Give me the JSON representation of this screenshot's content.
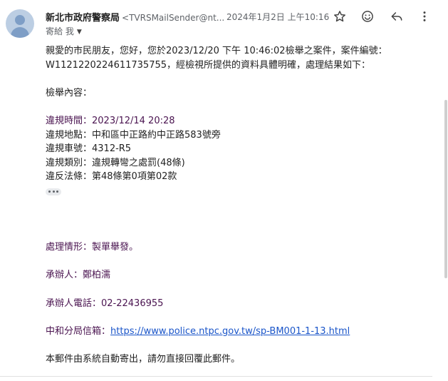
{
  "header": {
    "sender_name": "新北市政府警察局",
    "sender_email": "<TVRSMailSender@nt...",
    "date": "2024年1月2日 上午10:16",
    "recipient_label": "寄給 我",
    "icons": [
      "star-icon",
      "emoji-icon",
      "reply-icon",
      "more-vert-icon"
    ]
  },
  "body": {
    "greeting1": "親愛的市民朋友，您好，您於2023/12/20 下午 10:46:02檢舉之案件，案件編號：",
    "greeting2": "W1121220224611735755，經檢視所提供的資料具體明確，處理結果如下：",
    "report_title": "檢舉內容：",
    "violation_time": "違規時間：2023/12/14 20:28",
    "violation_place": "違規地點：中和區中正路約中正路583號旁",
    "plate": "違規車號：4312-R5",
    "category": "違規類別：違規轉彎之處罰(48條)",
    "law": "違反法條：第48條第0項第02款",
    "handling": "處理情形：製單舉發。",
    "handler": "承辦人：鄭柏濡",
    "phone": "承辦人電話：02-22436955",
    "mailbox_label": "中和分局信箱：",
    "mailbox_url": "https://www.police.ntpc.gov.tw/sp-BM001-1-13.html",
    "footer": "本郵件由系統自動寄出，請勿直接回覆此郵件。"
  },
  "colors": {
    "text": "#222222",
    "purple": "#4a1450",
    "link": "#1a55c9"
  }
}
